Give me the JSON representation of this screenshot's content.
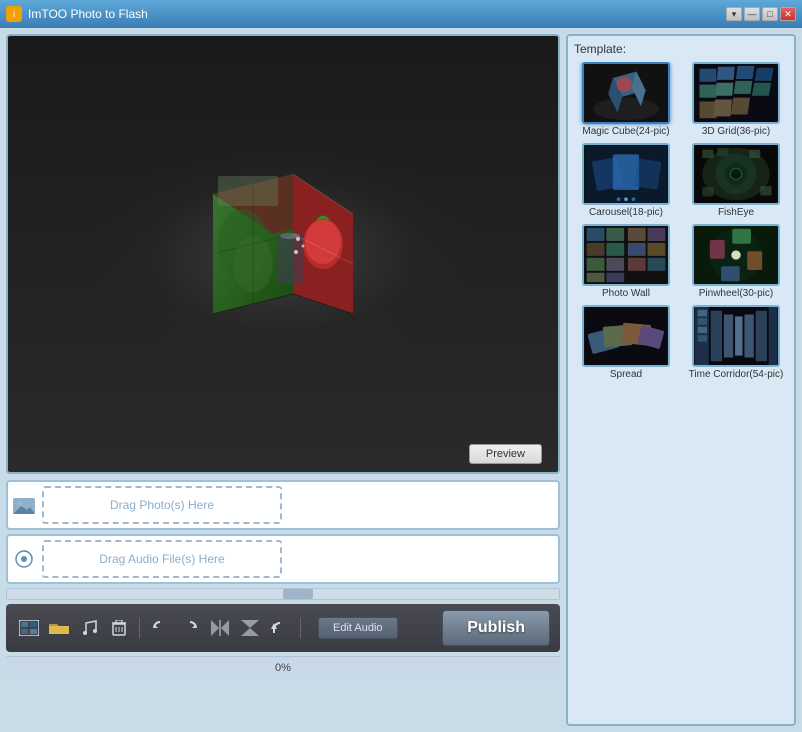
{
  "window": {
    "title": "ImTOO Photo to Flash",
    "controls": {
      "minimize": "—",
      "maximize": "□",
      "close": "✕",
      "collapse": "▾"
    }
  },
  "preview": {
    "button_label": "Preview"
  },
  "photo_drop": {
    "label": "Drag Photo(s) Here"
  },
  "audio_drop": {
    "label": "Drag Audio File(s) Here"
  },
  "template": {
    "section_label": "Template:",
    "items": [
      {
        "id": "magic-cube",
        "name": "Magic Cube(24-pic)",
        "color1": "#3a6080",
        "color2": "#1a3050"
      },
      {
        "id": "3d-grid",
        "name": "3D Grid(36-pic)",
        "color1": "#2a5070",
        "color2": "#1a3050"
      },
      {
        "id": "carousel",
        "name": "Carousel(18-pic)",
        "color1": "#1a4060",
        "color2": "#0a2040"
      },
      {
        "id": "fisheye",
        "name": "FishEye",
        "color1": "#1a2a3a",
        "color2": "#0a1a2a"
      },
      {
        "id": "photo-wall",
        "name": "Photo Wall",
        "color1": "#1a2030",
        "color2": "#0a1020"
      },
      {
        "id": "pinwheel",
        "name": "Pinwheel(30-pic)",
        "color1": "#1a3040",
        "color2": "#0a2030"
      },
      {
        "id": "spread",
        "name": "Spread",
        "color1": "#2a3a4a",
        "color2": "#1a2a3a"
      },
      {
        "id": "time-corridor",
        "name": "Time Corridor(54-pic)",
        "color1": "#2a4a5a",
        "color2": "#1a3a4a"
      }
    ]
  },
  "toolbar": {
    "edit_audio_label": "Edit Audio",
    "publish_label": "Publish"
  },
  "progress": {
    "value": "0%"
  }
}
